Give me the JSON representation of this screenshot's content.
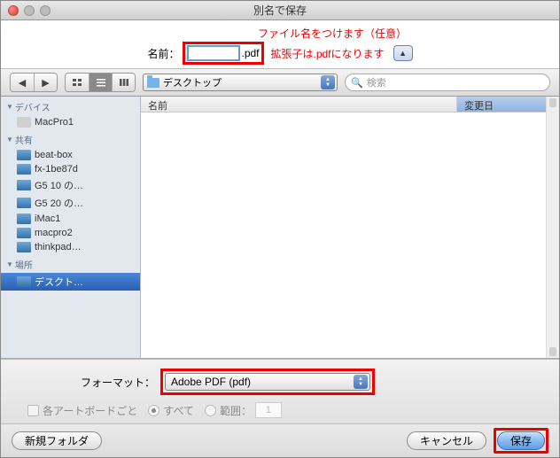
{
  "window": {
    "title": "別名で保存"
  },
  "annotations": {
    "filename_hint": "ファイル名をつけます（任意）",
    "extension_hint": "拡張子は.pdfになります"
  },
  "name_field": {
    "label": "名前：",
    "value": "",
    "extension": ".pdf"
  },
  "toolbar": {
    "location": "デスクトップ",
    "search_placeholder": "検索"
  },
  "sidebar": {
    "sections": [
      {
        "label": "デバイス",
        "items": [
          {
            "label": "MacPro1",
            "kind": "drive"
          }
        ]
      },
      {
        "label": "共有",
        "items": [
          {
            "label": "beat-box",
            "kind": "disp"
          },
          {
            "label": "fx-1be87d",
            "kind": "disp"
          },
          {
            "label": "G5 10 の…",
            "kind": "disp"
          },
          {
            "label": "G5 20 の…",
            "kind": "disp"
          },
          {
            "label": "iMac1",
            "kind": "disp"
          },
          {
            "label": "macpro2",
            "kind": "disp"
          },
          {
            "label": "thinkpad…",
            "kind": "disp"
          }
        ]
      },
      {
        "label": "場所",
        "items": [
          {
            "label": "デスクト…",
            "kind": "desktop",
            "selected": true
          }
        ]
      }
    ]
  },
  "filelist": {
    "columns": {
      "name": "名前",
      "date": "変更日"
    }
  },
  "format": {
    "label": "フォーマット：",
    "value": "Adobe PDF (pdf)"
  },
  "options": {
    "artboard_each": "各アートボードごと",
    "all": "すべて",
    "range": "範囲：",
    "range_value": "1"
  },
  "footer": {
    "new_folder": "新規フォルダ",
    "cancel": "キャンセル",
    "save": "保存"
  }
}
